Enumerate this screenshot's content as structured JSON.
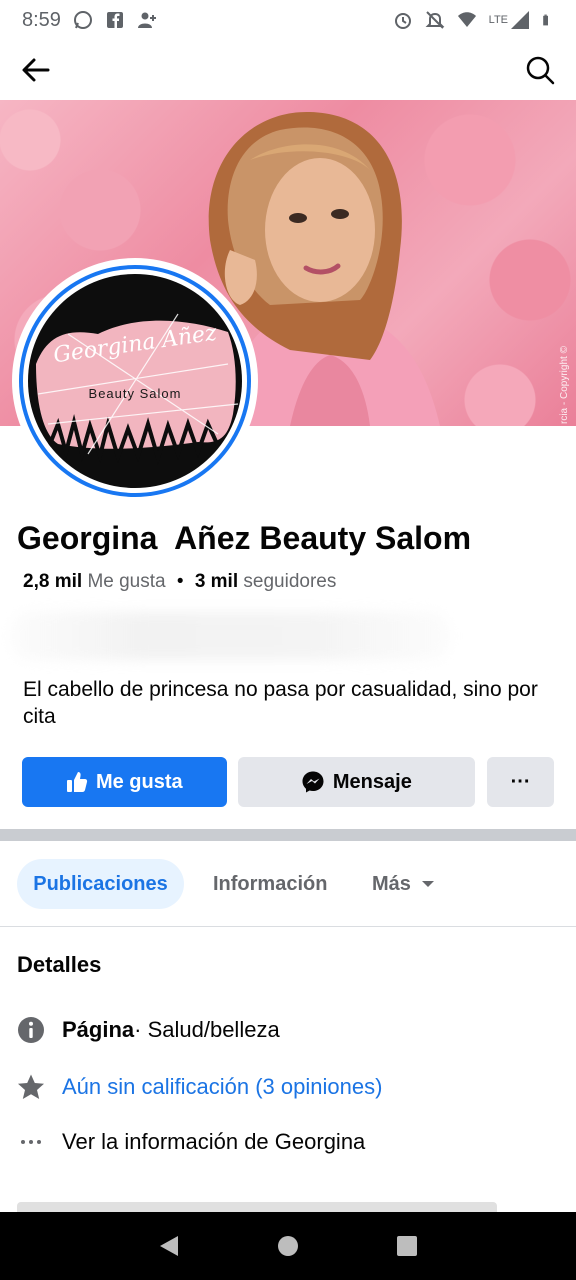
{
  "status_bar": {
    "time": "8:59",
    "network": "LTE",
    "icons_left": [
      "whatsapp-icon",
      "facebook-icon",
      "add-person-icon"
    ],
    "icons_right": [
      "alarm-icon",
      "mute-icon",
      "wifi-icon",
      "signal-icon",
      "battery-icon"
    ]
  },
  "nav": {
    "back_icon": "arrow-left-icon",
    "search_icon": "search-icon"
  },
  "cover": {
    "watermark": "rcia - Copyright ©"
  },
  "profile_logo": {
    "script_text": "Georgina Añez",
    "subtitle": "Beauty Salom"
  },
  "page": {
    "name": "Georgina  Añez Beauty Salom",
    "likes_count": "2,8 mil",
    "likes_label": "Me gusta",
    "separator": "•",
    "followers_count": "3 mil",
    "followers_label": "seguidores",
    "bio": "El cabello de princesa no pasa por casualidad, sino por cita"
  },
  "actions": {
    "like": "Me gusta",
    "message": "Mensaje",
    "more": "···"
  },
  "tabs": {
    "posts": "Publicaciones",
    "info": "Información",
    "more": "Más"
  },
  "details": {
    "title": "Detalles",
    "page_label": "Página",
    "page_category": " · Salud/belleza",
    "rating": "Aún sin calificación (3 opiniones)",
    "see_info": "Ver la información de Georgina"
  },
  "colors": {
    "accent": "#1877f2",
    "link": "#1b74e4",
    "secondary_button": "#e4e6eb",
    "logo_pink": "#f2b5bf"
  }
}
